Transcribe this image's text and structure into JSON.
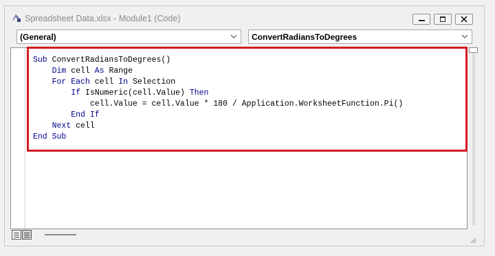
{
  "window": {
    "title": "Spreadsheet Data.xlsx - Module1 (Code)",
    "icons": {
      "app": "vba-module-icon",
      "minimize": "minimize-icon",
      "maximize": "maximize-icon",
      "close": "close-icon"
    }
  },
  "dropdowns": {
    "object": {
      "value": "(General)",
      "icon": "chevron-down-icon"
    },
    "procedure": {
      "value": "ConvertRadiansToDegrees",
      "icon": "chevron-down-icon"
    }
  },
  "code_lines": [
    "Sub ConvertRadiansToDegrees()",
    "    Dim cell As Range",
    "    For Each cell In Selection",
    "        If IsNumeric(cell.Value) Then",
    "            cell.Value = cell.Value * 180 / Application.WorksheetFunction.Pi()",
    "        End If",
    "    Next cell",
    "End Sub"
  ],
  "colors": {
    "keyword": "#00008b",
    "highlight_border": "#d71920"
  },
  "bottom_bar": {
    "procedure_view_icon": "procedure-view-icon",
    "full_module_view_icon": "full-module-view-icon"
  }
}
